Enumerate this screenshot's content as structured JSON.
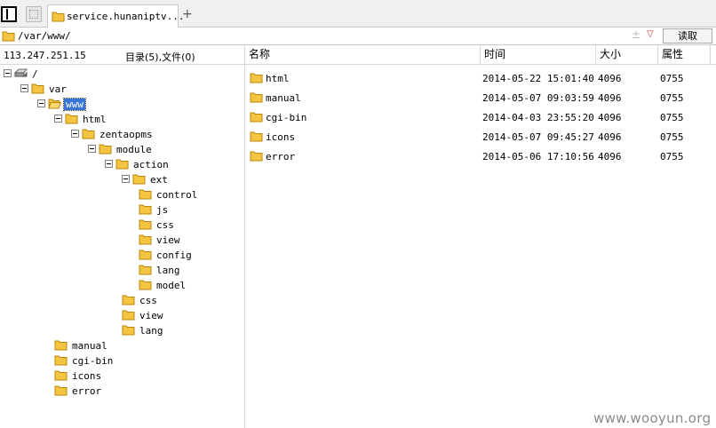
{
  "tab": {
    "title": "service.hunaniptv...",
    "new_tab": "+"
  },
  "address": {
    "path": "/var/www/",
    "plusminus": "±",
    "dropdown": "▽",
    "read_button": "读取"
  },
  "left": {
    "ip": "113.247.251.15",
    "counts": "目录(5),文件(0)"
  },
  "tree": [
    {
      "label": "/",
      "depth": 0,
      "toggle": true,
      "icon": "drive-icon"
    },
    {
      "label": "var",
      "depth": 1,
      "toggle": true,
      "icon": "folder-icon"
    },
    {
      "label": "www",
      "depth": 2,
      "toggle": true,
      "icon": "folder-open-icon",
      "selected": true
    },
    {
      "label": "html",
      "depth": 3,
      "toggle": true,
      "icon": "folder-icon"
    },
    {
      "label": "zentaopms",
      "depth": 4,
      "toggle": true,
      "icon": "folder-icon"
    },
    {
      "label": "module",
      "depth": 5,
      "toggle": true,
      "icon": "folder-icon"
    },
    {
      "label": "action",
      "depth": 6,
      "toggle": true,
      "icon": "folder-icon"
    },
    {
      "label": "ext",
      "depth": 7,
      "toggle": true,
      "icon": "folder-icon"
    },
    {
      "label": "control",
      "depth": 8,
      "toggle": false,
      "icon": "folder-icon"
    },
    {
      "label": "js",
      "depth": 8,
      "toggle": false,
      "icon": "folder-icon"
    },
    {
      "label": "css",
      "depth": 8,
      "toggle": false,
      "icon": "folder-icon"
    },
    {
      "label": "view",
      "depth": 8,
      "toggle": false,
      "icon": "folder-icon"
    },
    {
      "label": "config",
      "depth": 8,
      "toggle": false,
      "icon": "folder-icon"
    },
    {
      "label": "lang",
      "depth": 8,
      "toggle": false,
      "icon": "folder-icon"
    },
    {
      "label": "model",
      "depth": 8,
      "toggle": false,
      "icon": "folder-icon"
    },
    {
      "label": "css",
      "depth": 7,
      "toggle": false,
      "icon": "folder-icon"
    },
    {
      "label": "view",
      "depth": 7,
      "toggle": false,
      "icon": "folder-icon"
    },
    {
      "label": "lang",
      "depth": 7,
      "toggle": false,
      "icon": "folder-icon"
    },
    {
      "label": "manual",
      "depth": 3,
      "toggle": false,
      "icon": "folder-icon"
    },
    {
      "label": "cgi-bin",
      "depth": 3,
      "toggle": false,
      "icon": "folder-icon"
    },
    {
      "label": "icons",
      "depth": 3,
      "toggle": false,
      "icon": "folder-icon"
    },
    {
      "label": "error",
      "depth": 3,
      "toggle": false,
      "icon": "folder-icon"
    }
  ],
  "columns": [
    "名称",
    "时间",
    "大小",
    "属性"
  ],
  "files": [
    {
      "name": "html",
      "time": "2014-05-22 15:01:40",
      "size": "4096",
      "perm": "0755"
    },
    {
      "name": "manual",
      "time": "2014-05-07 09:03:59",
      "size": "4096",
      "perm": "0755"
    },
    {
      "name": "cgi-bin",
      "time": "2014-04-03 23:55:20",
      "size": "4096",
      "perm": "0755"
    },
    {
      "name": "icons",
      "time": "2014-05-07 09:45:27",
      "size": "4096",
      "perm": "0755"
    },
    {
      "name": "error",
      "time": "2014-05-06 17:10:56",
      "size": "4096",
      "perm": "0755"
    }
  ],
  "watermark": "www.wooyun.org",
  "colors": {
    "folder": "#f5c542",
    "folder_stroke": "#b8860b",
    "selection": "#3875d7"
  }
}
